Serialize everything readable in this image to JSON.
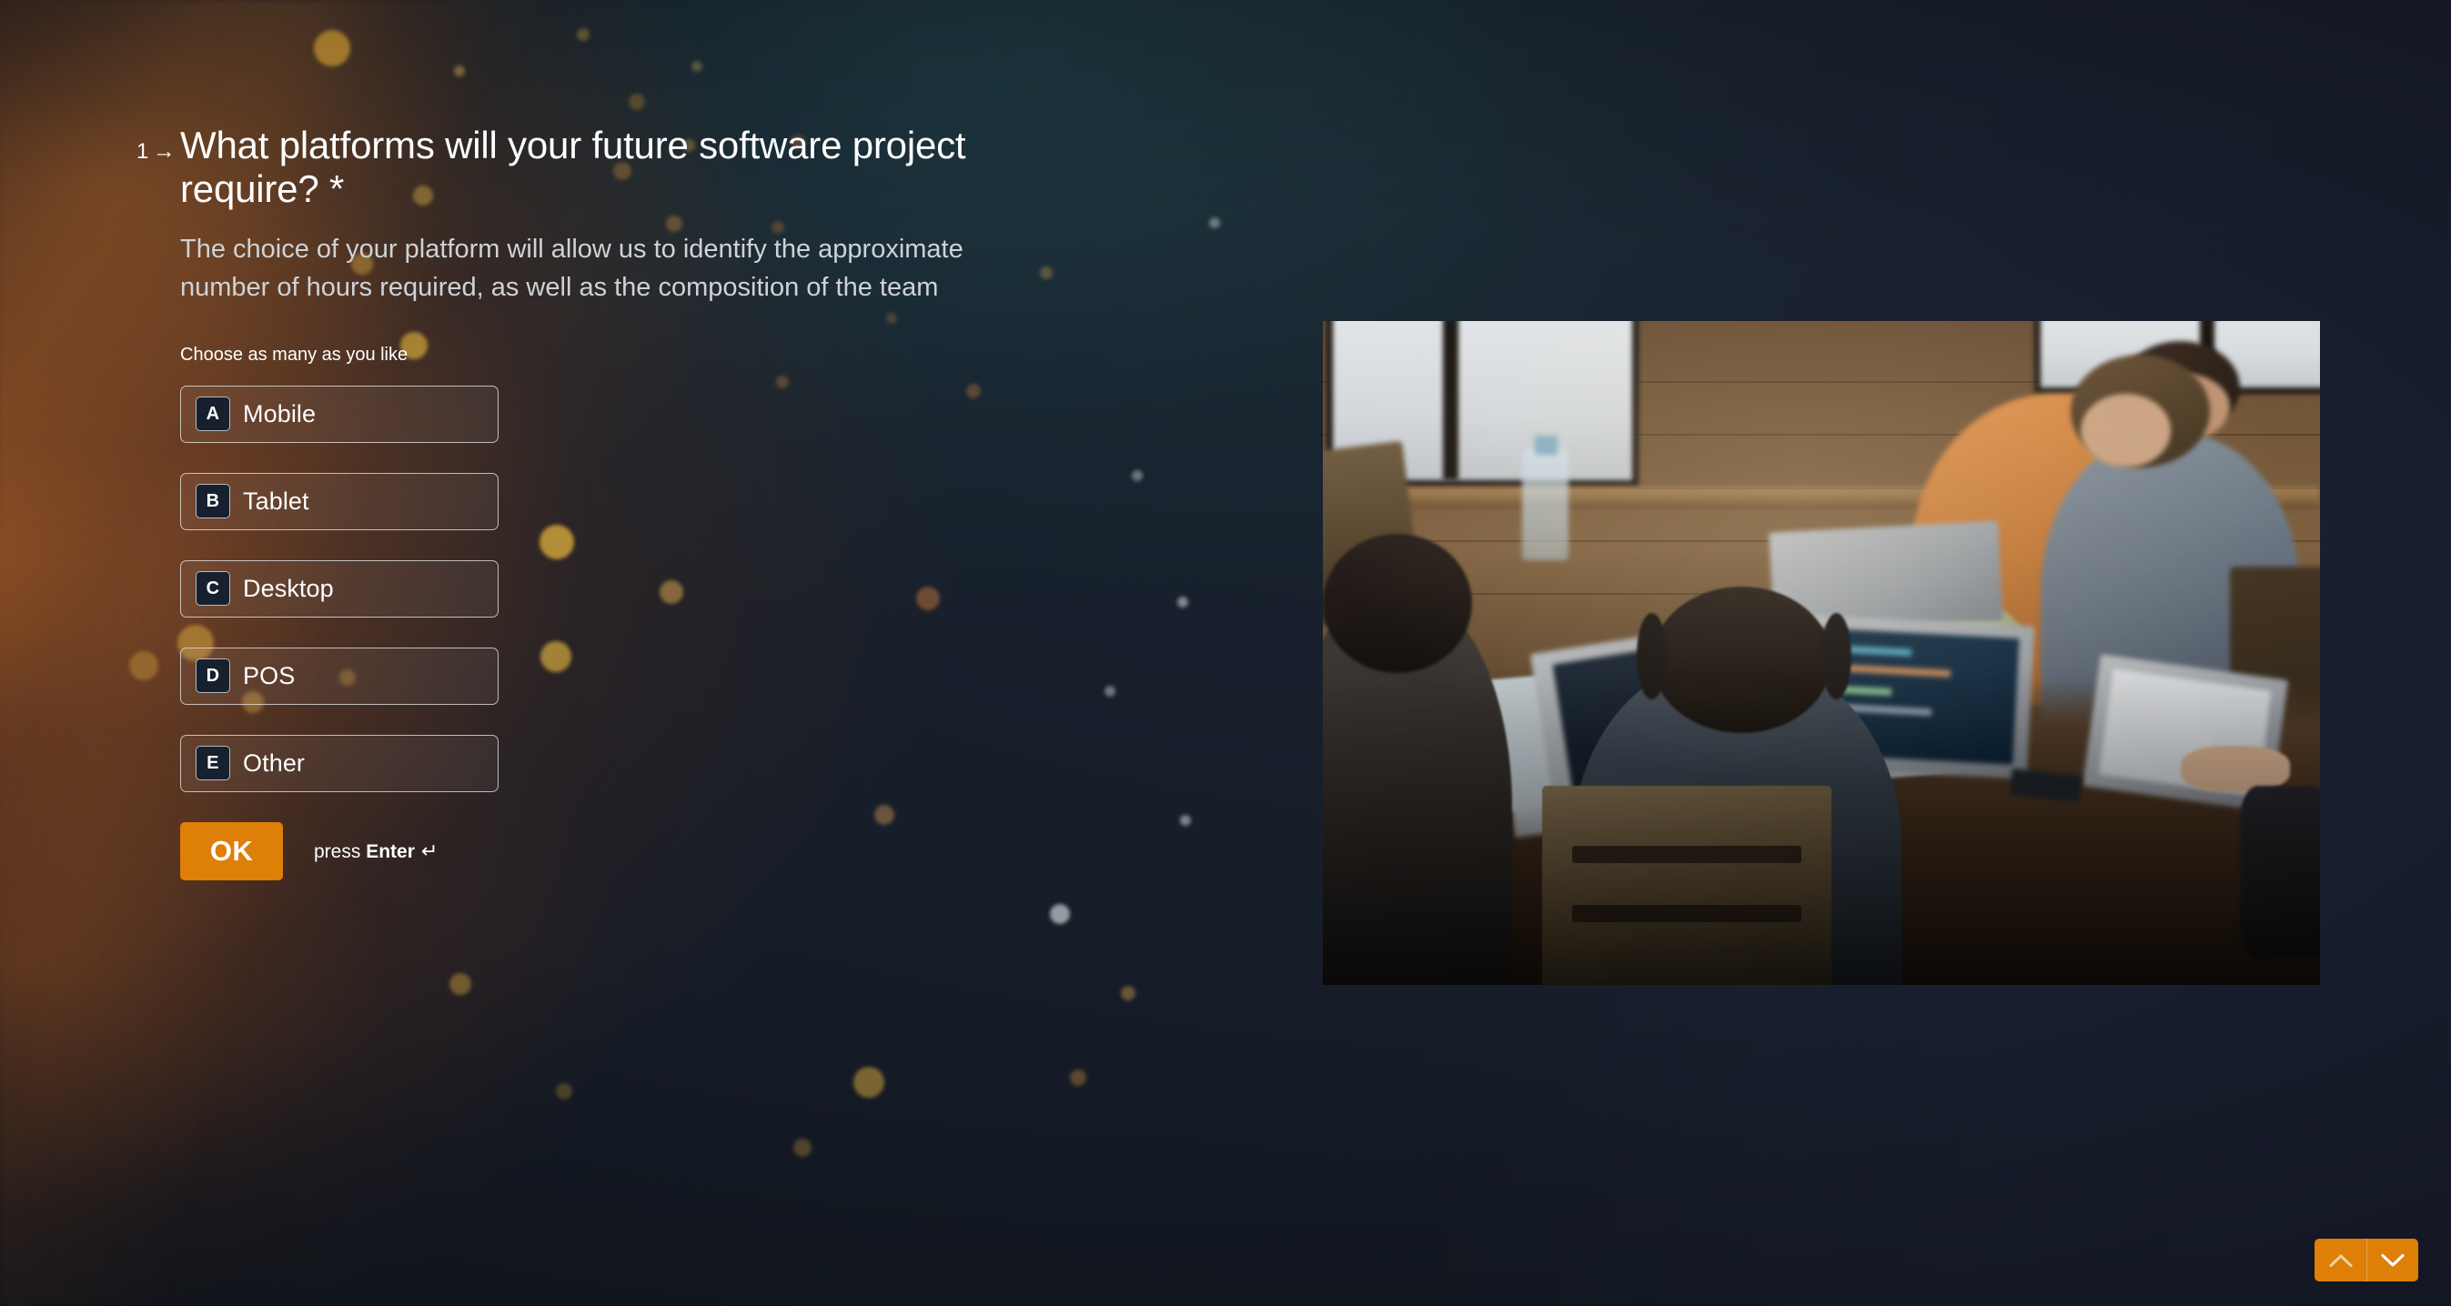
{
  "question": {
    "number": "1",
    "number_arrow": "→",
    "title": "What platforms will your future software project require? *",
    "description": "The choice of your platform will allow us to identify the approximate number of hours required, as well as the composition of the team",
    "selection_hint": "Choose as many as you like"
  },
  "choices": [
    {
      "key": "A",
      "label": "Mobile"
    },
    {
      "key": "B",
      "label": "Tablet"
    },
    {
      "key": "C",
      "label": "Desktop"
    },
    {
      "key": "D",
      "label": "POS"
    },
    {
      "key": "E",
      "label": "Other"
    }
  ],
  "submit": {
    "ok_label": "OK",
    "hint_prefix": "press",
    "hint_key": "Enter",
    "hint_return_glyph": "↵"
  },
  "navigation": {
    "up_icon": "chevron-up-icon",
    "down_icon": "chevron-down-icon"
  },
  "media": {
    "photo_alt": "Team of people working on laptops around a wooden table in a wood-panelled room"
  },
  "colors": {
    "accent_orange": "#de7f08",
    "page_background": "#1a2030",
    "key_badge_background": "#16202e",
    "title_text": "#ffffff",
    "description_text": "#cfd2d6"
  }
}
